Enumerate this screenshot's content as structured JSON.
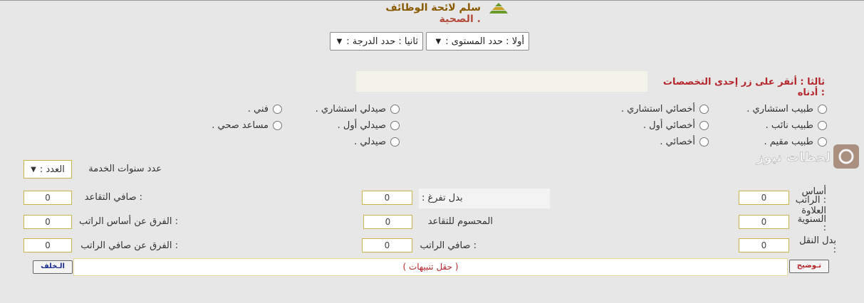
{
  "title": {
    "part1": "سلم لائحة الوظائف",
    "part2": "الصحية ."
  },
  "selects": {
    "level": "أولا : حدد المستوى :",
    "grade": "ثانيا : حدد الدرجة :"
  },
  "step3": "ثالثا : أنقر على زر إحدى التخصصات أدناه :",
  "specialties": {
    "col1": [
      "طبيب استشاري .",
      "طبيب نائب .",
      "طبيب مقيم ."
    ],
    "col2": [
      "أخصائي استشاري .",
      "أخصائي أول .",
      "أخصائي ."
    ],
    "col3": [
      "صيدلي استشاري .",
      "صيدلي أول .",
      "صيدلي ."
    ],
    "col4": [
      "فني .",
      "مساعد صحي ."
    ]
  },
  "service_years": {
    "label": "عدد سنوات الخدمة",
    "select": "العدد :"
  },
  "fields": {
    "basic_salary": {
      "label": "أساس الراتب :",
      "value": "0"
    },
    "annual_increment": {
      "label": "العلاوة السنوية :",
      "value": "0"
    },
    "transport_allowance": {
      "label": "بدل النقل :",
      "value": "0"
    },
    "full_time_allowance": {
      "label": "بدل تفرغ :",
      "value": "0"
    },
    "retirement_deduction": {
      "label": "المحسوم للتقاعد",
      "value": "0"
    },
    "net_salary": {
      "label": "صافي الراتب :",
      "value": "0"
    },
    "net_retirement": {
      "label": "صافي التقاعد :",
      "value": "0"
    },
    "diff_basic": {
      "label": "الفرق عن أساس الراتب :",
      "value": "0"
    },
    "diff_net": {
      "label": "الفرق عن صافي الراتب :",
      "value": "0"
    }
  },
  "notes": "( حقل تنبيهات )",
  "buttons": {
    "back": "الـخلف",
    "explain": "تـوضيح"
  },
  "watermark": "لحظات نيوز",
  "colors": {
    "accent_red": "#b3262b",
    "title_brown": "#8a5a00",
    "background": "#e7e7e7"
  }
}
